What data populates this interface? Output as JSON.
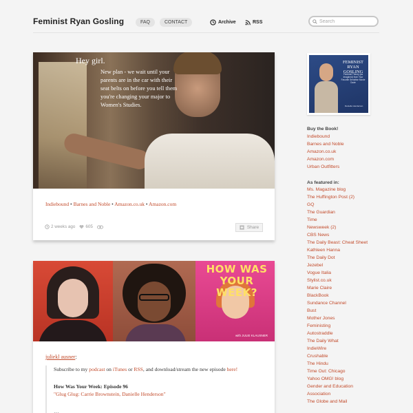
{
  "header": {
    "site_title": "Feminist Ryan Gosling",
    "nav": {
      "faq": "FAQ",
      "contact": "CONTACT",
      "archive": "Archive",
      "rss": "RSS"
    },
    "search_placeholder": "Search"
  },
  "post1": {
    "image_text": {
      "greeting": "Hey girl.",
      "caption": "New plan - we wait until your parents are in the car with their seat belts on before you tell them you're changing your major to Women's Studies."
    },
    "links": [
      "Indiebound",
      "Barnes and Noble",
      "Amazon.co.uk",
      "Amazon.com"
    ],
    "separator": "•",
    "meta": {
      "time": "2 weeks ago",
      "likes": "605"
    },
    "share_label": "Share"
  },
  "post2": {
    "image_text": {
      "show_title": "HOW WAS YOUR WEEK?",
      "credit": "with JULIE KLAUSNER"
    },
    "reblog_user": "juliekl ausner",
    "quote": {
      "intro_1": "Subscribe to my ",
      "podcast_link": "podcast",
      "intro_2": " on ",
      "itunes_link": "iTunes",
      "intro_3": " or ",
      "rss_link": "RSS",
      "intro_4": ", and download/stream the new episode ",
      "here_link": "here!",
      "episode_title": "How Was Your Week: Episode 96",
      "episode_guests": "\"Glug Glug: Carrie Brownstein, Danielle Henderson\"",
      "cut_text": "…"
    }
  },
  "sidebar": {
    "book": {
      "title": "FEMINIST RYAN GOSLING",
      "subtitle": "Feminist Theory (as Imagined) from Your Favorite Sensitive Movie Dude",
      "author": "Danielle Henderson"
    },
    "buy_heading": "Buy the Book!",
    "buy_links": [
      "Indiebound",
      "Barnes and Noble",
      "Amazon.co.uk",
      "Amazon.com",
      "Urban Outfitters"
    ],
    "featured_heading": "As featured in:",
    "featured_links": [
      "Ms. Magazine blog",
      "The Huffington Post (2)",
      "GQ",
      "The Guardian",
      "Time",
      "Newsweek (2)",
      "CBS News",
      "The Daily Beast: Cheat Sheet",
      "Kathleen Hanna",
      "The Daily Dot",
      "Jezebel",
      "Vogue Italia",
      "Stylist.co.uk",
      "Marie Claire",
      "BlackBook",
      "Sundance Channel",
      "Bust",
      "Mother Jones",
      "Feministing",
      "Autostraddle",
      "The Daily What",
      "IndieWire",
      "Crushable",
      "The Hindu",
      "Time Out: Chicago",
      "Yahoo OMG! blog",
      "Gender and Education",
      "Association",
      "The Globe and Mail"
    ]
  },
  "colors": {
    "link": "#c24a2a",
    "background": "#f4f4f4"
  }
}
